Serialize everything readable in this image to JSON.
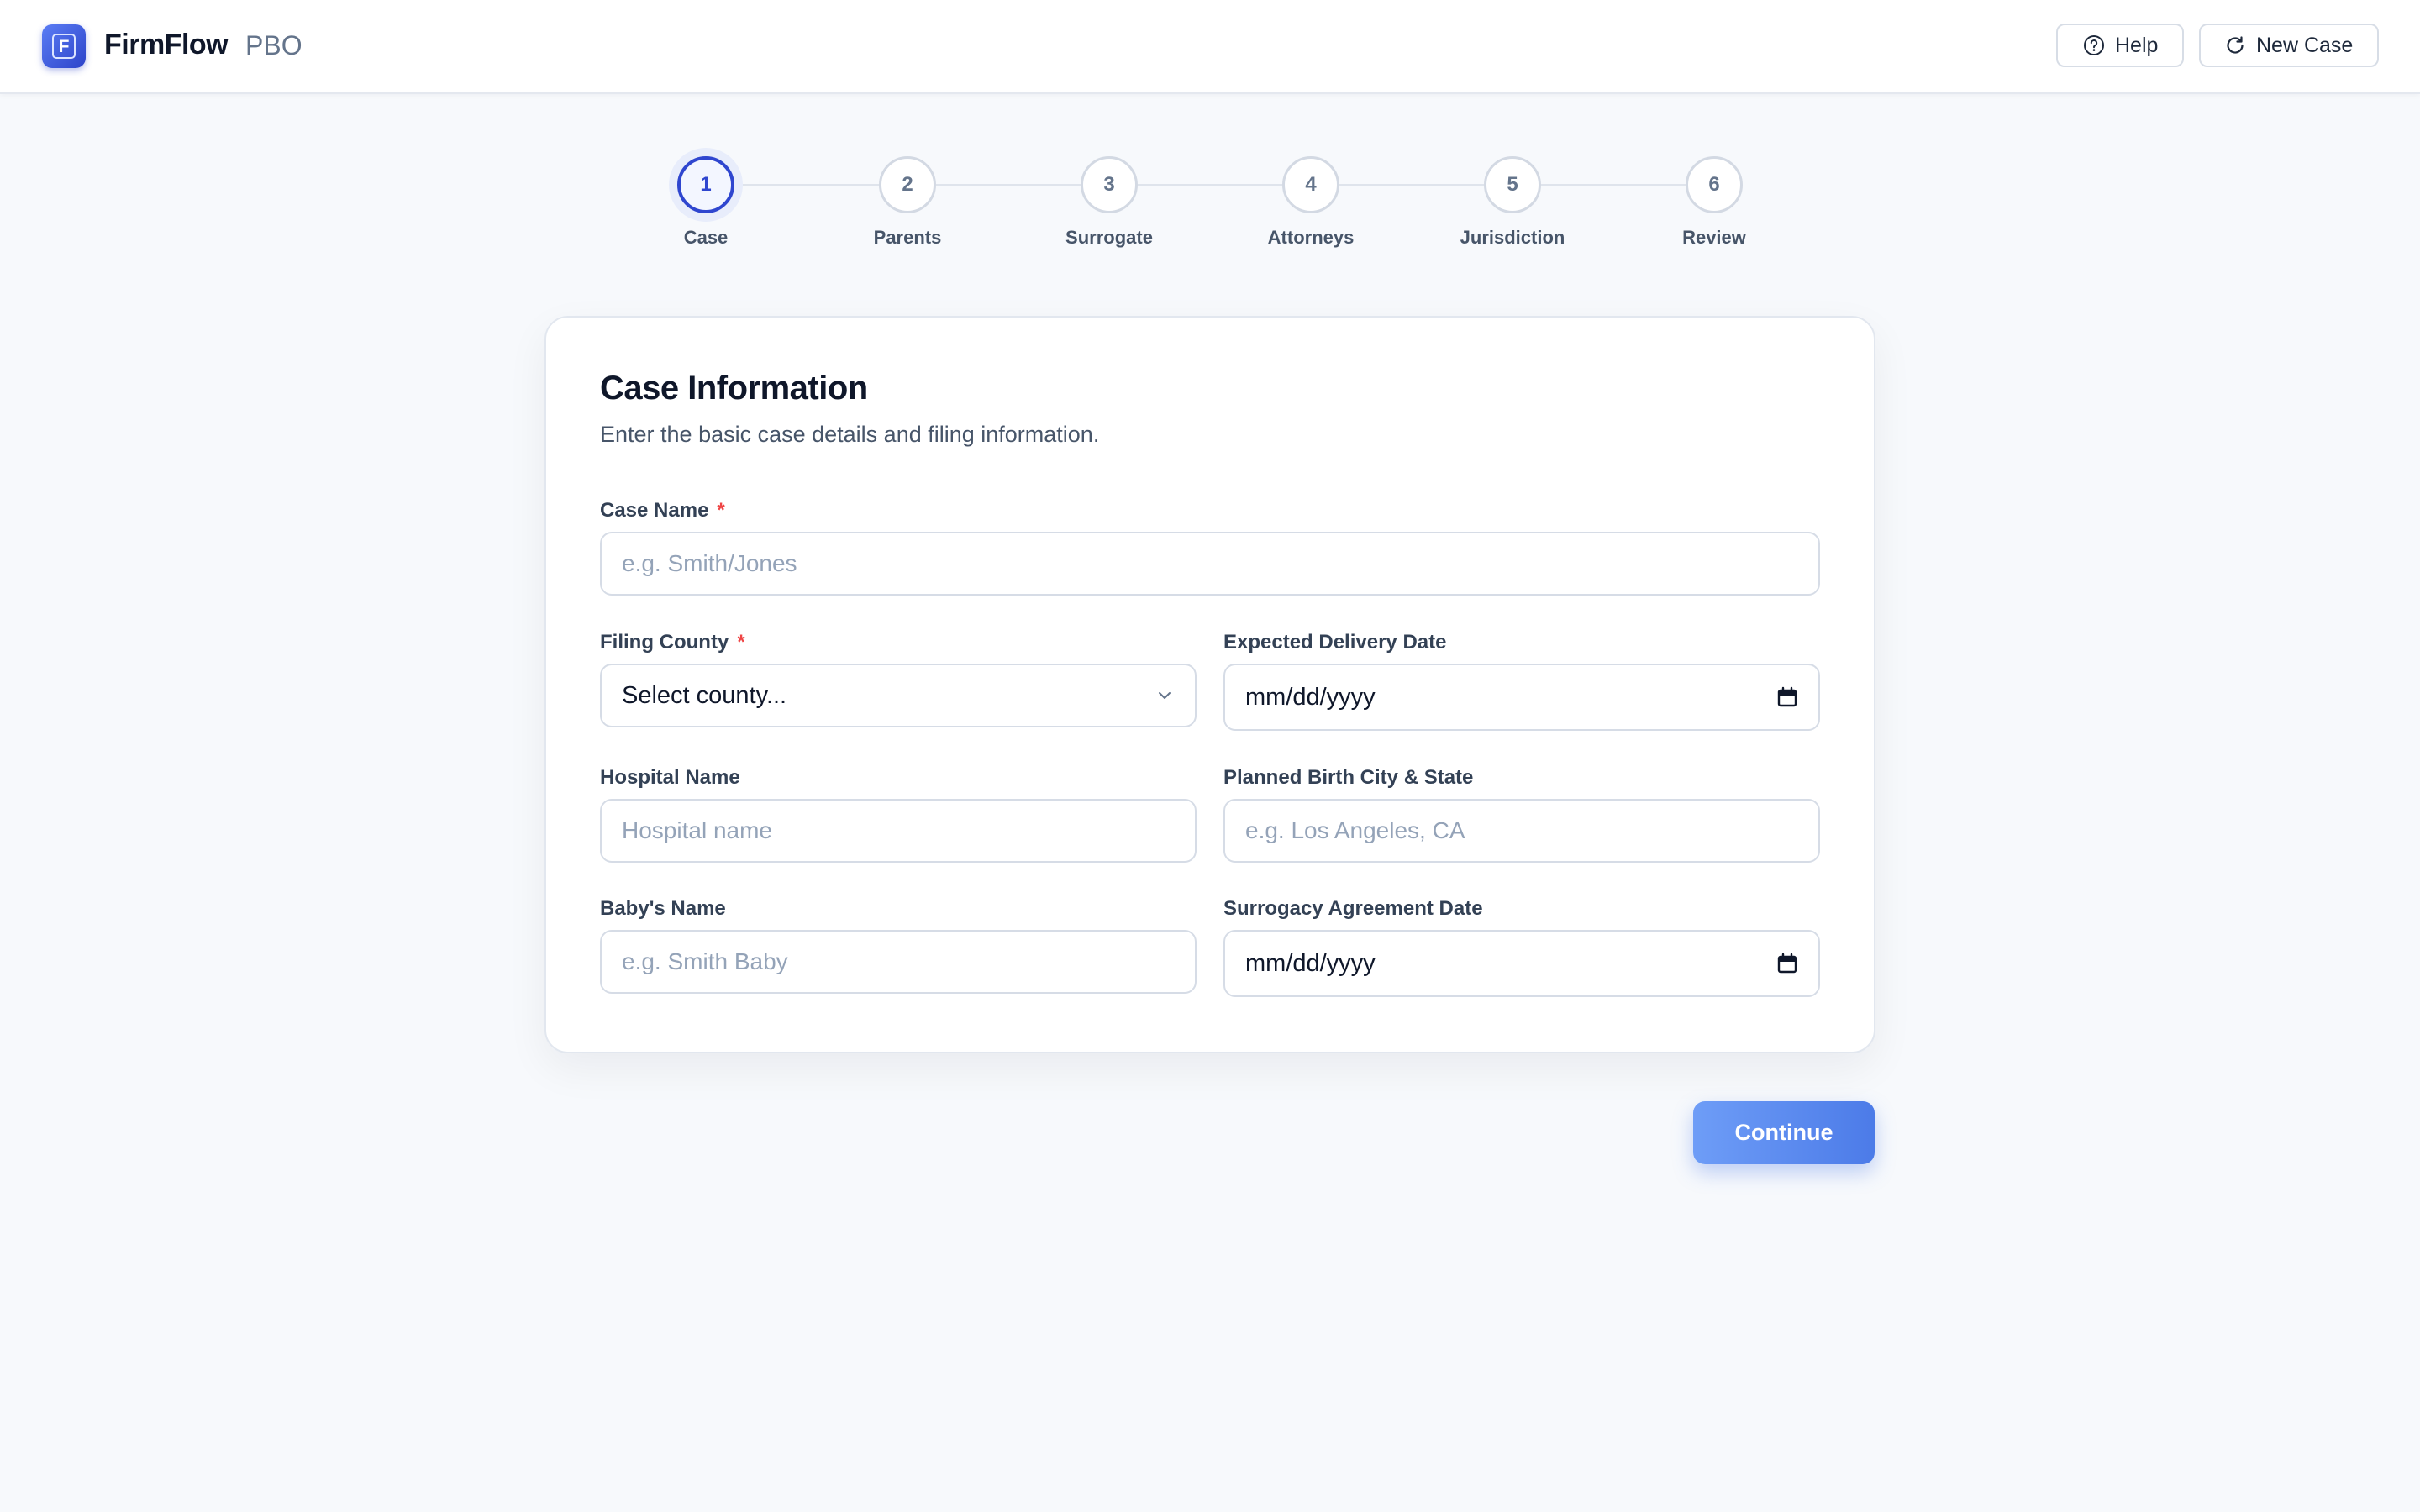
{
  "header": {
    "brand": "FirmFlow",
    "brand_sub": "PBO",
    "logo_letter": "F",
    "help_label": "Help",
    "new_case_label": "New Case"
  },
  "stepper": {
    "current_step": 1,
    "steps": [
      {
        "number": "1",
        "label": "Case"
      },
      {
        "number": "2",
        "label": "Parents"
      },
      {
        "number": "3",
        "label": "Surrogate"
      },
      {
        "number": "4",
        "label": "Attorneys"
      },
      {
        "number": "5",
        "label": "Jurisdiction"
      },
      {
        "number": "6",
        "label": "Review"
      }
    ]
  },
  "form": {
    "title": "Case Information",
    "subtitle": "Enter the basic case details and filing information.",
    "required_marker": "*",
    "case_name": {
      "label": "Case Name",
      "placeholder": "e.g. Smith/Jones",
      "value": ""
    },
    "filing_county": {
      "label": "Filing County",
      "value": "Select county..."
    },
    "expected_delivery_date": {
      "label": "Expected Delivery Date",
      "value": "mm/dd/yyyy"
    },
    "hospital_name": {
      "label": "Hospital Name",
      "placeholder": "Hospital name",
      "value": ""
    },
    "planned_birth_city_state": {
      "label": "Planned Birth City & State",
      "placeholder": "e.g. Los Angeles, CA",
      "value": ""
    },
    "babys_name": {
      "label": "Baby's Name",
      "placeholder": "e.g. Smith Baby",
      "value": ""
    },
    "surrogacy_agreement_date": {
      "label": "Surrogacy Agreement Date",
      "value": "mm/dd/yyyy"
    }
  },
  "actions": {
    "continue_label": "Continue"
  },
  "colors": {
    "accent": "#2f46cf",
    "button": "#5a8bf0",
    "required": "#ef4444",
    "background": "#f7f9fc"
  }
}
